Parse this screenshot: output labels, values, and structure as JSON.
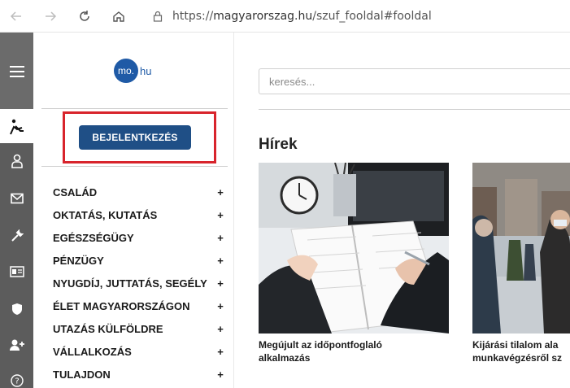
{
  "browser": {
    "url_prefix": "https://",
    "url_host": "magyarorszag.hu",
    "url_path": "/szuf_fooldal#fooldal"
  },
  "rail": {
    "icons": [
      "menu-icon",
      "accessibility-icon",
      "user-icon",
      "mail-icon",
      "wrench-icon",
      "id-card-icon",
      "shield-icon",
      "add-user-icon",
      "help-icon"
    ]
  },
  "logo": {
    "mark": "mo.",
    "suffix": "hu"
  },
  "login": {
    "label": "BEJELENTKEZÉS"
  },
  "menu": {
    "items": [
      {
        "label": "CSALÁD",
        "toggle": "+"
      },
      {
        "label": "OKTATÁS, KUTATÁS",
        "toggle": "+"
      },
      {
        "label": "EGÉSZSÉGÜGY",
        "toggle": "+"
      },
      {
        "label": "PÉNZÜGY",
        "toggle": "+"
      },
      {
        "label": "NYUGDÍJ, JUTTATÁS, SEGÉLY",
        "toggle": "+"
      },
      {
        "label": "ÉLET MAGYARORSZÁGON",
        "toggle": "+"
      },
      {
        "label": "UTAZÁS KÜLFÖLDRE",
        "toggle": "+"
      },
      {
        "label": "VÁLLALKOZÁS",
        "toggle": "+"
      },
      {
        "label": "TULAJDON",
        "toggle": "+"
      }
    ]
  },
  "search": {
    "placeholder": "keresés..."
  },
  "news": {
    "title": "Hírek",
    "cards": [
      {
        "line1": "Megújult az időpontfoglaló",
        "line2": "alkalmazás"
      },
      {
        "line1": "Kijárási tilalom ala",
        "line2": "munkavégzésről sz"
      }
    ]
  }
}
